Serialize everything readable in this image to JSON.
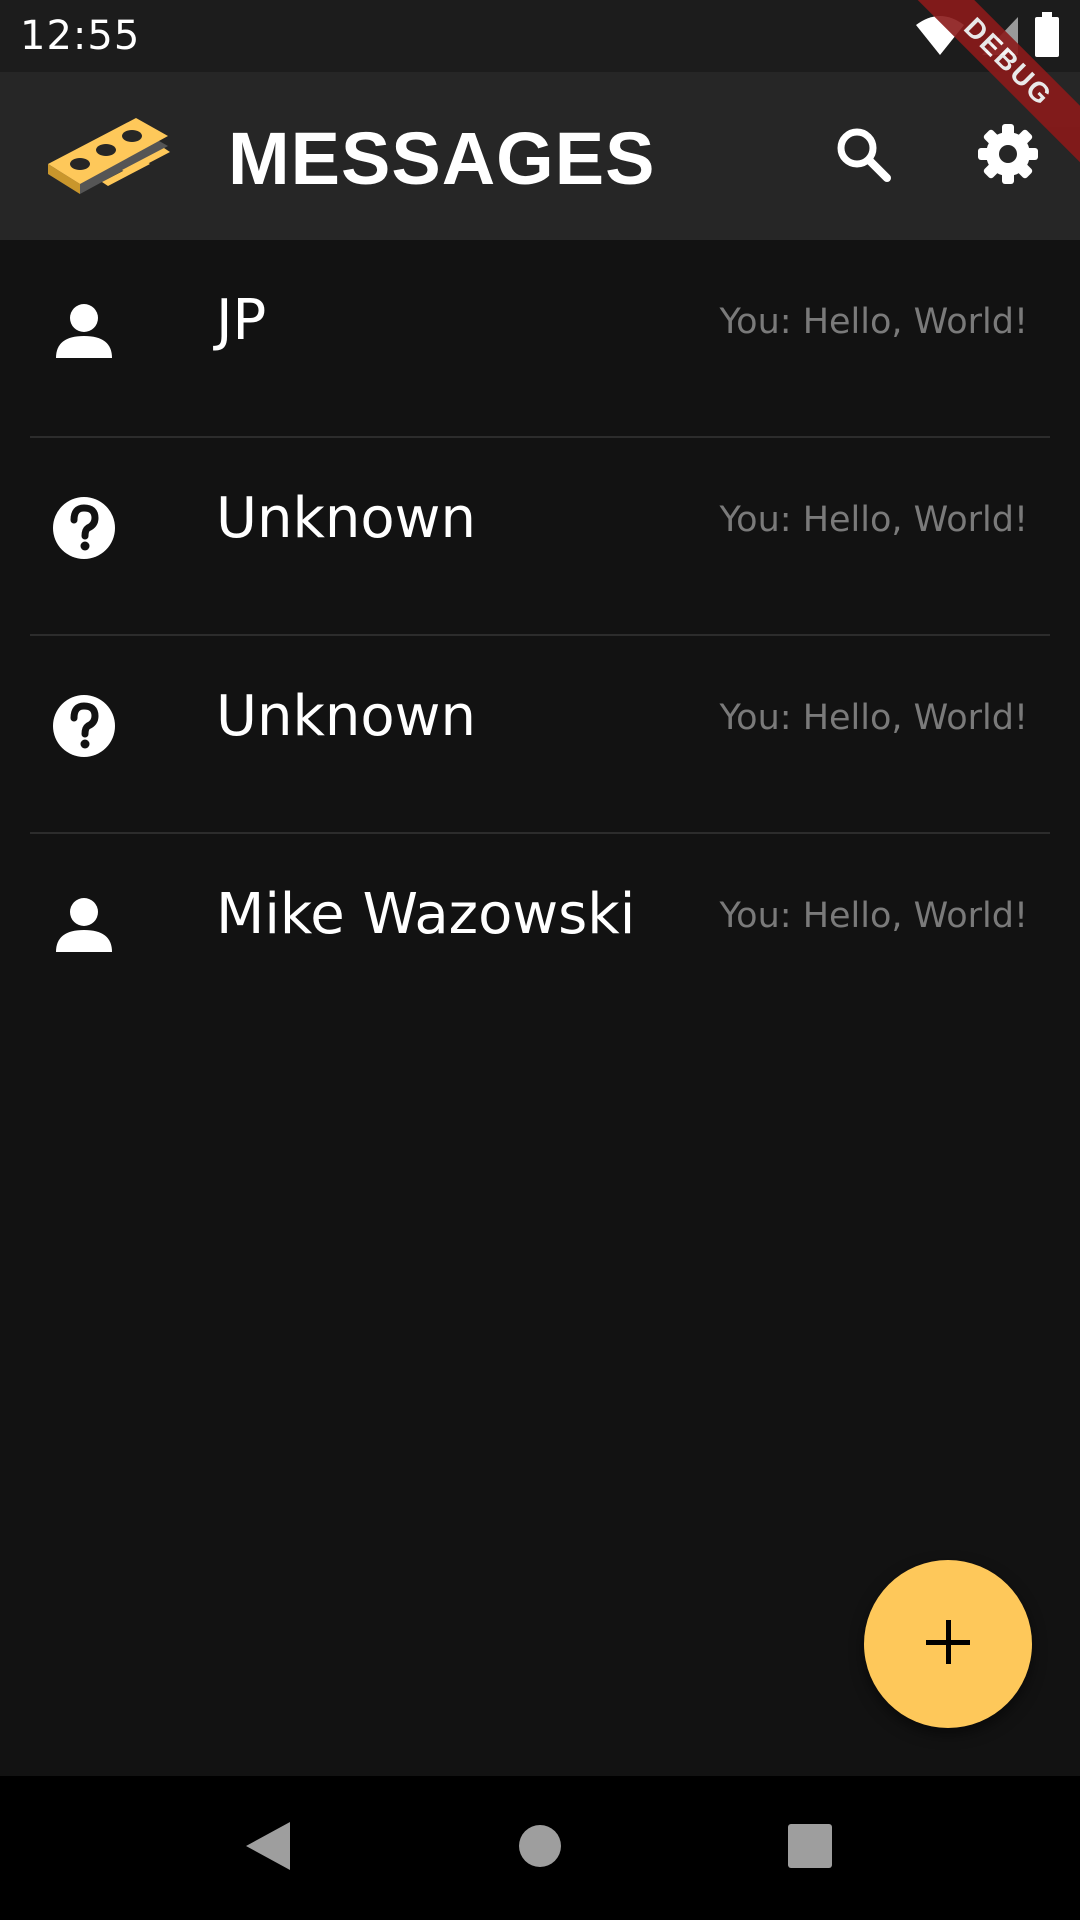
{
  "status_bar": {
    "time": "12:55",
    "icons": [
      "wifi-icon",
      "cellular-signal-icon",
      "battery-icon"
    ]
  },
  "app_bar": {
    "title": "MESSAGES",
    "logo": "app-logo",
    "actions": [
      {
        "name": "search-icon",
        "label": "Search"
      },
      {
        "name": "settings-icon",
        "label": "Settings"
      }
    ]
  },
  "debug_banner": "DEBUG",
  "conversations": [
    {
      "name": "JP",
      "icon": "person-icon",
      "preview": "You: Hello, World!"
    },
    {
      "name": "Unknown",
      "icon": "help-circle-icon",
      "preview": "You: Hello, World!"
    },
    {
      "name": "Unknown",
      "icon": "help-circle-icon",
      "preview": "You: Hello, World!"
    },
    {
      "name": "Mike Wazowski",
      "icon": "person-icon",
      "preview": "You: Hello, World!"
    }
  ],
  "fab": {
    "icon": "plus-icon",
    "label": "New message"
  },
  "nav_bar": {
    "buttons": [
      "back-icon",
      "home-icon",
      "recents-icon"
    ]
  },
  "colors": {
    "background": "#121212",
    "app_bar": "#262626",
    "status_bar": "#1c1c1c",
    "accent": "#fec85a",
    "preview_text": "#7a7a7a",
    "divider": "#2c2c2c",
    "debug_ribbon": "#8b1a1a"
  }
}
